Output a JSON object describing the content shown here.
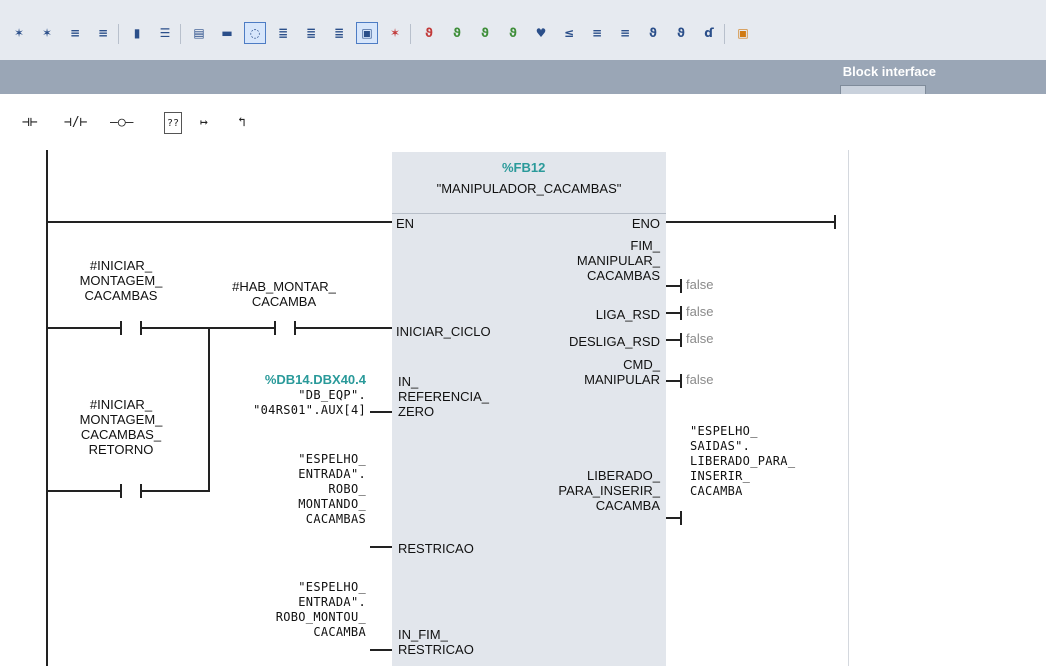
{
  "toolbar": {
    "icons": [
      "insert-network-icon",
      "delete-network-icon",
      "insert-row-icon",
      "add-row-icon",
      "network-toggle-icon",
      "absolute-operands-icon",
      "networks-expand-icon",
      "networks-collapse-icon",
      "comments-icon",
      "favorites-icon",
      "open-all-networks-icon",
      "close-all-networks-icon",
      "display-favorites-icon",
      "set-breakpoint-icon",
      "clear-breakpoint-icon",
      "monitor-icon",
      "watch-table-icon",
      "force-icon",
      "jump-up-icon",
      "jump-down-icon",
      "callstack-icon",
      "go-to-icon",
      "return-icon",
      "link-icon",
      "glasses-icon",
      "database-icon"
    ]
  },
  "block_interface": {
    "label": "Block interface"
  },
  "ladder_toolbar": {
    "buttons": [
      {
        "name": "normally-open-contact-button",
        "glyph": "⊣⊢"
      },
      {
        "name": "normally-closed-contact-button",
        "glyph": "⊣/⊢"
      },
      {
        "name": "output-coil-button",
        "glyph": "–○–"
      },
      {
        "name": "empty-box-button",
        "glyph": "??"
      },
      {
        "name": "open-branch-button",
        "glyph": "↦"
      },
      {
        "name": "close-branch-button",
        "glyph": "↰"
      }
    ]
  },
  "fb": {
    "address": "%FB12",
    "name": "\"MANIPULADOR_CACAMBAS\"",
    "inputs": {
      "en": "EN",
      "iniciar_ciclo": "INICIAR_CICLO",
      "in_referencia_zero": "IN_\nREFERENCIA_\nZERO",
      "restricao": "RESTRICAO",
      "in_fim_restricao": "IN_FIM_\nRESTRICAO"
    },
    "outputs": {
      "eno": "ENO",
      "fim_manipular_cacambas": "FIM_\nMANIPULAR_\nCACAMBAS",
      "liga_rsd": "LIGA_RSD",
      "desliga_rsd": "DESLIGA_RSD",
      "cmd_manipular": "CMD_\nMANIPULAR",
      "liberado_para_inserir_cacamba": "LIBERADO_\nPARA_INSERIR_\nCACAMBA"
    }
  },
  "operands": {
    "iniciar_montagem": "#INICIAR_\nMONTAGEM_\nCACAMBAS",
    "hab_montar": "#HAB_MONTAR_\nCACAMBA",
    "iniciar_montagem_retorno": "#INICIAR_\nMONTAGEM_\nCACAMBAS_\nRETORNO",
    "ref_zero_address": "%DB14.DBX40.4",
    "ref_zero_symbol": "\"DB_EQP\".\n\"04RS01\".AUX[4]",
    "restricao_symbol": "\"ESPELHO_\nENTRADA\".\nROBO_\nMONTANDO_\nCACAMBAS",
    "fim_restricao_symbol": "\"ESPELHO_\nENTRADA\".\nROBO_MONTOU_\nCACAMBA",
    "liberado_symbol": "\"ESPELHO_\nSAIDAS\".\nLIBERADO_PARA_\nINSERIR_\nCACAMBA"
  },
  "values": {
    "fim_manipular": "false",
    "liga_rsd": "false",
    "desliga_rsd": "false",
    "cmd_manipular": "false"
  },
  "colors": {
    "address": "#2a9a9a",
    "value": "#8a8a8a",
    "block": "#e2e6ec",
    "header_bar": "#9aa6b6"
  }
}
